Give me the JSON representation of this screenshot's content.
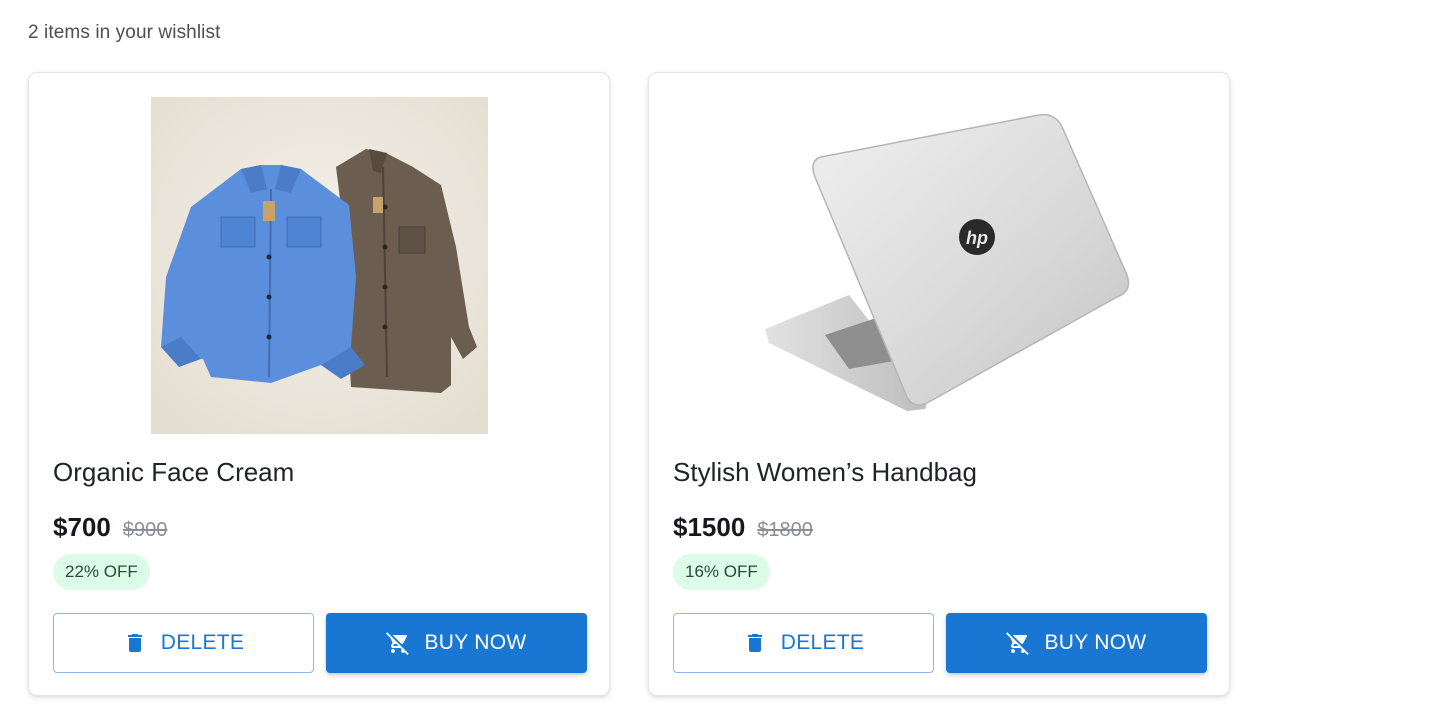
{
  "summary": "2 items in your wishlist",
  "items": [
    {
      "title": "Organic Face Cream",
      "price": "$700",
      "old_price": "$900",
      "discount": "22% OFF",
      "image_icon": "shirts-image",
      "delete_label": "DELETE",
      "buy_label": "BUY NOW"
    },
    {
      "title": "Stylish Women’s Handbag",
      "price": "$1500",
      "old_price": "$1800",
      "discount": "16% OFF",
      "image_icon": "laptop-image",
      "delete_label": "DELETE",
      "buy_label": "BUY NOW"
    }
  ],
  "colors": {
    "primary": "#1976d2",
    "badge_bg": "#dcfce7",
    "border": "#e3e5e8"
  }
}
